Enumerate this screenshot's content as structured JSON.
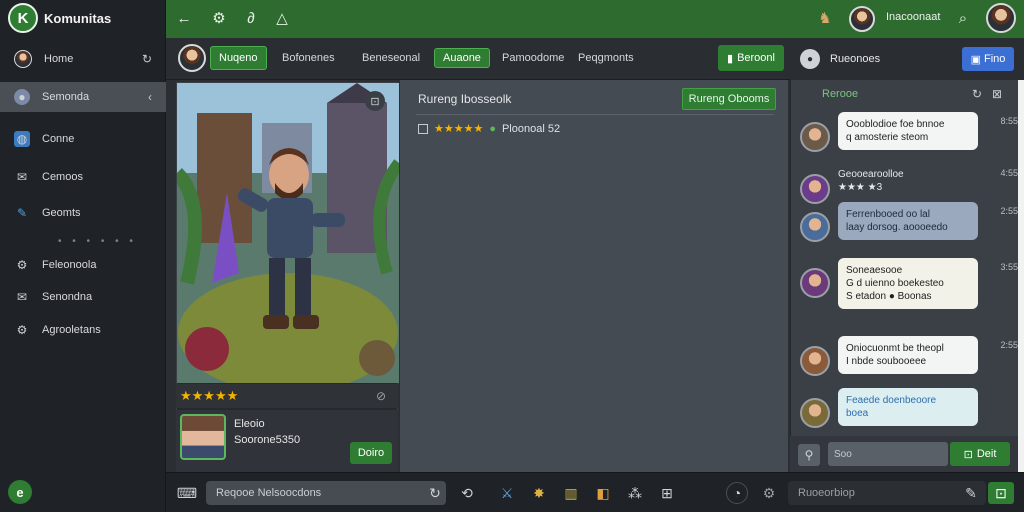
{
  "app": {
    "name": "Komunitas",
    "logo_letter": "K"
  },
  "sidebar": {
    "items": [
      {
        "label": "Home",
        "icon": "avatar-icon",
        "trail": "↻"
      },
      {
        "label": "Semonda",
        "icon": "user-icon",
        "trail": "‹"
      },
      {
        "label": "Conne",
        "icon": "globe-icon",
        "trail": ""
      },
      {
        "label": "Cemoos",
        "icon": "mail-icon",
        "trail": ""
      },
      {
        "label": "Geomts",
        "icon": "pen-icon",
        "trail": ""
      },
      {
        "label": "Feleonoola",
        "icon": "gear-icon",
        "trail": ""
      },
      {
        "label": "Senondna",
        "icon": "mail-icon",
        "trail": ""
      },
      {
        "label": "Agrooletans",
        "icon": "gear-icon",
        "trail": ""
      }
    ],
    "dots": "• • • • • •",
    "help_letter": "e"
  },
  "topbar": {
    "user_name": "Inacoonaat"
  },
  "tabs": [
    {
      "label": "Nuqeno",
      "selected": true
    },
    {
      "label": "Bofonenes",
      "selected": false
    },
    {
      "label": "Beneseonal",
      "selected": false
    },
    {
      "label": "Auaone",
      "selected": true
    },
    {
      "label": "Pamoodome",
      "selected": false
    },
    {
      "label": "Peqgmonts",
      "selected": false
    }
  ],
  "record_button": "Beroonl",
  "card": {
    "rating": 5,
    "stars": "★★★★★",
    "name": "Eleoio",
    "subtitle": "Soorone5350",
    "action": "Doiro"
  },
  "middle": {
    "title": "Rureng Ibosseolk",
    "button": "Rureng Obooms",
    "row": {
      "stars": "★★★★★",
      "text": "Ploonoal 52"
    }
  },
  "chat": {
    "title": "Rueonoes",
    "button": "Fino",
    "subtitle": "Rerooe",
    "messages": [
      {
        "text": "Oooblodioe foe bnnoe\nq amosterie steom",
        "time": "8:55",
        "avatar": "#6b5a4a",
        "bubble": "#f3f4f4"
      },
      {
        "text": "Geooearoolloe\n★★★ ★3",
        "time": "4:55",
        "avatar": "#6a3c8a",
        "bubble": "transparent"
      },
      {
        "text": "Ferrenbooed oo lal\nlaay dorsog. aoooeedo",
        "time": "2:55",
        "avatar": "#4a6c9a",
        "bubble": "#9aa9bd"
      },
      {
        "text": "Soneaesooe\nG d uienno boekesteo\nS etadon ● Boonas",
        "time": "3:55",
        "avatar": "#6b3a7a",
        "bubble": "#f3f2e8"
      },
      {
        "text": "Oniocuonmt be theopl\nI nbde soubooeee",
        "time": "2:55",
        "avatar": "#8a5a3a",
        "bubble": "#f3f4f4"
      },
      {
        "text": "Feaede doenbeoore\nboea",
        "time": "",
        "avatar": "#7a6a3a",
        "bubble": "#dceef0"
      }
    ],
    "input_placeholder": "Soo",
    "send_label": "Deit"
  },
  "bottombar": {
    "search_placeholder": "Reqooe Nelsoocdons",
    "search2_placeholder": "Ruoeorbiop"
  }
}
